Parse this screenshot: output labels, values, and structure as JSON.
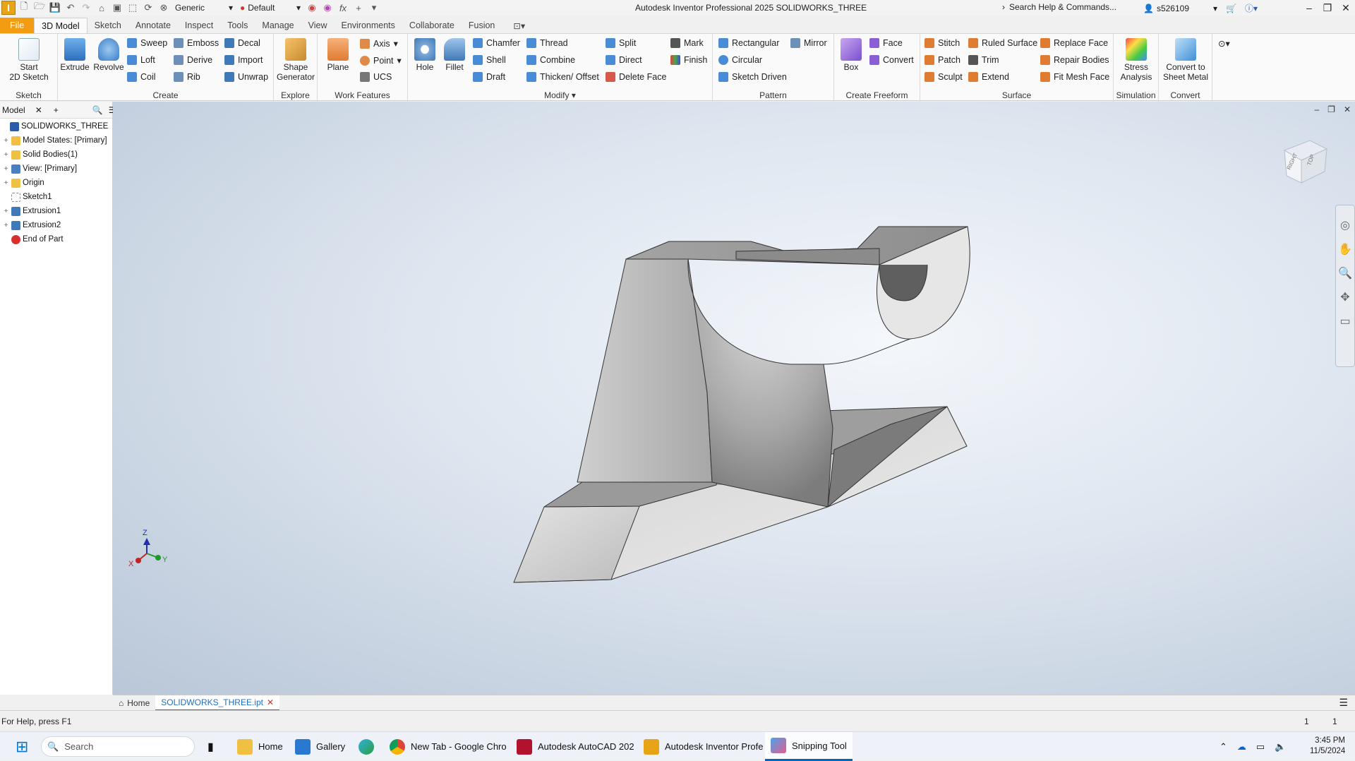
{
  "window": {
    "title": "Autodesk Inventor Professional 2025   SOLIDWORKS_THREE",
    "search_placeholder": "Search Help & Commands...",
    "user": "s526109",
    "material": "Generic",
    "appearance": "Default",
    "app_icon_letter": "I"
  },
  "ribbon_tabs": [
    "File",
    "3D Model",
    "Sketch",
    "Annotate",
    "Inspect",
    "Tools",
    "Manage",
    "View",
    "Environments",
    "Collaborate",
    "Fusion"
  ],
  "active_tab": "3D Model",
  "ribbon": {
    "sketch": {
      "start_label": "Start\n2D Sketch",
      "panel": "Sketch"
    },
    "create": {
      "extrude": "Extrude",
      "revolve": "Revolve",
      "sweep": "Sweep",
      "loft": "Loft",
      "coil": "Coil",
      "emboss": "Emboss",
      "derive": "Derive",
      "rib": "Rib",
      "decal": "Decal",
      "import": "Import",
      "unwrap": "Unwrap",
      "panel": "Create"
    },
    "explore": {
      "shape_generator": "Shape\nGenerator",
      "panel": "Explore"
    },
    "work": {
      "plane": "Plane",
      "axis": "Axis",
      "point": "Point",
      "ucs": "UCS",
      "panel": "Work Features"
    },
    "modify": {
      "hole": "Hole",
      "fillet": "Fillet",
      "chamfer": "Chamfer",
      "shell": "Shell",
      "draft": "Draft",
      "thread": "Thread",
      "combine": "Combine",
      "thicken": "Thicken/ Offset",
      "split": "Split",
      "direct": "Direct",
      "delete_face": "Delete Face",
      "mark": "Mark",
      "finish": "Finish",
      "panel": "Modify"
    },
    "pattern": {
      "rectangular": "Rectangular",
      "circular": "Circular",
      "sketch_driven": "Sketch Driven",
      "mirror": "Mirror",
      "panel": "Pattern"
    },
    "freeform": {
      "box": "Box",
      "face": "Face",
      "convert": "Convert",
      "panel": "Create Freeform"
    },
    "surface": {
      "stitch": "Stitch",
      "patch": "Patch",
      "sculpt": "Sculpt",
      "ruled": "Ruled Surface",
      "trim": "Trim",
      "extend": "Extend",
      "replace": "Replace Face",
      "repair": "Repair Bodies",
      "fitmesh": "Fit Mesh Face",
      "panel": "Surface"
    },
    "simulation": {
      "stress": "Stress\nAnalysis",
      "panel": "Simulation"
    },
    "convert": {
      "sheetmetal": "Convert to\nSheet Metal",
      "panel": "Convert"
    }
  },
  "browser": {
    "tab": "Model",
    "items": [
      {
        "label": "SOLIDWORKS_THREE",
        "indent": 0,
        "expand": ""
      },
      {
        "label": "Model States: [Primary]",
        "indent": 1,
        "expand": "+"
      },
      {
        "label": "Solid Bodies(1)",
        "indent": 1,
        "expand": "+"
      },
      {
        "label": "View: [Primary]",
        "indent": 1,
        "expand": "+"
      },
      {
        "label": "Origin",
        "indent": 1,
        "expand": "+"
      },
      {
        "label": "Sketch1",
        "indent": 1,
        "expand": ""
      },
      {
        "label": "Extrusion1",
        "indent": 1,
        "expand": "+"
      },
      {
        "label": "Extrusion2",
        "indent": 1,
        "expand": "+"
      },
      {
        "label": "End of Part",
        "indent": 1,
        "expand": ""
      }
    ]
  },
  "viewcube": {
    "faces": [
      "RIGHT",
      "TOP"
    ]
  },
  "triad": {
    "z": "Z",
    "x": "X",
    "y": "Y"
  },
  "doc_tabs": {
    "home": "Home",
    "file": "SOLIDWORKS_THREE.ipt"
  },
  "status": {
    "help": "For Help, press F1",
    "count1": "1",
    "count2": "1"
  },
  "taskbar": {
    "search": "Search",
    "items": [
      "Home",
      "Gallery",
      "New Tab - Google Chro",
      "Autodesk AutoCAD 202",
      "Autodesk Inventor Profe",
      "Snipping Tool"
    ],
    "time": "3:45 PM",
    "date": "11/5/2024"
  }
}
